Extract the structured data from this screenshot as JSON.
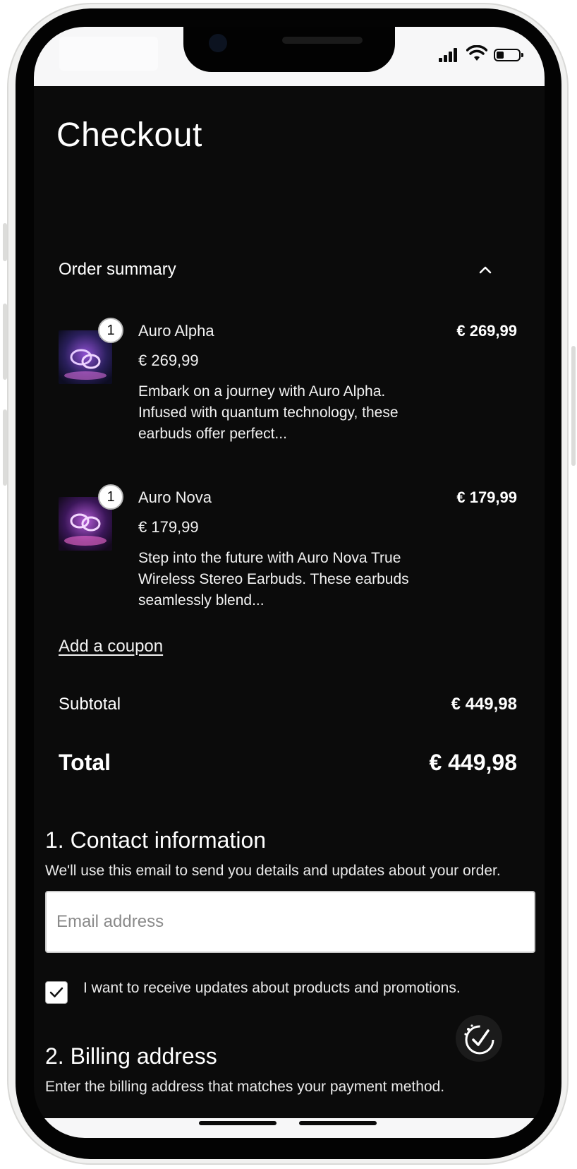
{
  "page": {
    "title": "Checkout"
  },
  "order_summary": {
    "heading": "Order summary",
    "items": [
      {
        "quantity": "1",
        "name": "Auro Alpha",
        "unit_price": "€ 269,99",
        "description": "Embark on a journey with Auro Alpha. Infused with quantum technology, these earbuds offer perfect...",
        "line_total": "€ 269,99",
        "thumb_colors": [
          "#3a2a8a",
          "#c05ac8"
        ]
      },
      {
        "quantity": "1",
        "name": "Auro Nova",
        "unit_price": "€ 179,99",
        "description": "Step into the future with Auro Nova True Wireless Stereo Earbuds. These earbuds seamlessly blend...",
        "line_total": "€ 179,99",
        "thumb_colors": [
          "#4a1f7a",
          "#e06ad8"
        ]
      }
    ],
    "coupon_link": "Add a coupon",
    "subtotal_label": "Subtotal",
    "subtotal_value": "€ 449,98",
    "total_label": "Total",
    "total_value": "€ 449,98"
  },
  "contact": {
    "heading": "1. Contact information",
    "description": "We'll use this email to send you details and updates about your order.",
    "email_placeholder": "Email address",
    "email_value": "",
    "newsletter_label": "I want to receive updates about products and promotions.",
    "newsletter_checked": true
  },
  "billing": {
    "heading": "2. Billing address",
    "description": "Enter the billing address that matches your payment method."
  },
  "status_bar": {
    "battery_level": 0.35
  },
  "colors": {
    "background": "#0b0b0b",
    "text": "#ffffff",
    "input_bg": "#ffffff"
  },
  "icons": {
    "collapse": "chevron-up-icon",
    "check": "checkmark-icon",
    "fab": "verified-check-icon"
  }
}
